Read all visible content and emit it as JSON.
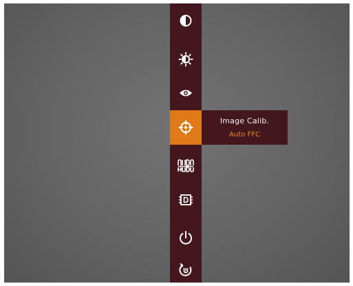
{
  "menu": {
    "items": [
      {
        "name": "contrast-icon"
      },
      {
        "name": "brightness-icon"
      },
      {
        "name": "eye-icon"
      },
      {
        "name": "calibration-crosshair-icon",
        "active": true
      },
      {
        "name": "audio-icon"
      },
      {
        "name": "chip-d-icon"
      },
      {
        "name": "power-icon"
      },
      {
        "name": "restore-icon"
      }
    ],
    "active_color": "#e07a18",
    "bar_color": "#43171d"
  },
  "submenu": {
    "title": "Image Calib.",
    "value": "Auto FFC",
    "value_color": "#e68a2b"
  }
}
